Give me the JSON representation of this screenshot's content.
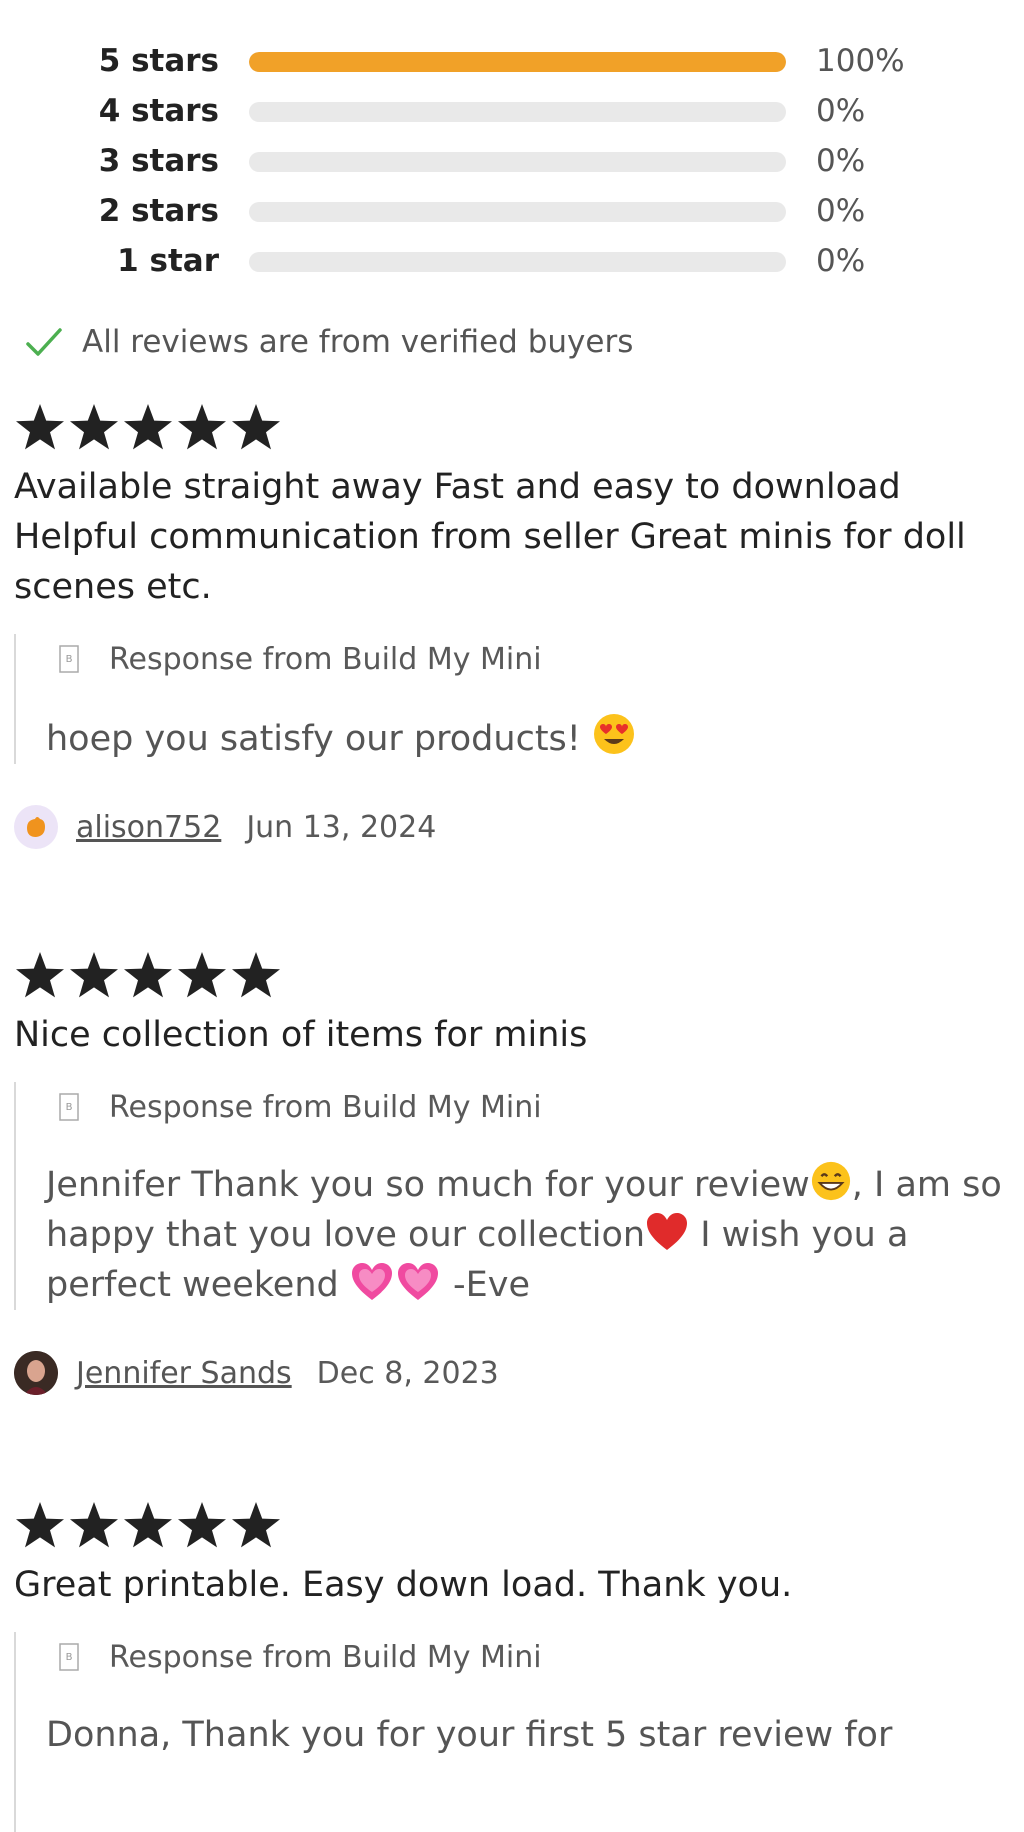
{
  "rating_distribution": [
    {
      "label": "5 stars",
      "percent_text": "100%",
      "fill": 1.0
    },
    {
      "label": "4 stars",
      "percent_text": "0%",
      "fill": 0
    },
    {
      "label": "3 stars",
      "percent_text": "0%",
      "fill": 0
    },
    {
      "label": "2 stars",
      "percent_text": "0%",
      "fill": 0
    },
    {
      "label": "1 star",
      "percent_text": "0%",
      "fill": 0
    }
  ],
  "verified_text": "All reviews are from verified buyers",
  "colors": {
    "bar_fill": "#f1a128",
    "bar_track": "#e9e9e9",
    "check": "#4caf50",
    "star": "#222222"
  },
  "reviews": [
    {
      "rating": 5,
      "text": "Available straight away Fast and easy to download Helpful communication from seller Great minis for doll scenes etc.",
      "response_heading": "Response from Build My Mini",
      "response_text": "hoep you satisfy our products!",
      "response_emoji": [
        "heart-eyes-emoji"
      ],
      "reviewer": "alison752",
      "date": "Jun 13, 2024",
      "avatar": "hand-avatar-icon"
    },
    {
      "rating": 5,
      "text": "Nice collection of items for minis",
      "response_heading": "Response from Build My Mini",
      "response_parts": [
        "Jennifer Thank you so much for your review",
        ", I am so happy that you love our collection",
        " I wish you a perfect weekend ",
        " -Eve"
      ],
      "response_emoji": [
        "grinning-emoji",
        "red-heart-emoji",
        "pink-hearts-emoji"
      ],
      "reviewer": "Jennifer Sands",
      "date": "Dec 8, 2023",
      "avatar": "photo-avatar"
    },
    {
      "rating": 5,
      "text": "Great printable. Easy down load. Thank you.",
      "response_heading": "Response from Build My Mini",
      "response_text": "Donna, Thank you for your first 5 star review for"
    }
  ]
}
